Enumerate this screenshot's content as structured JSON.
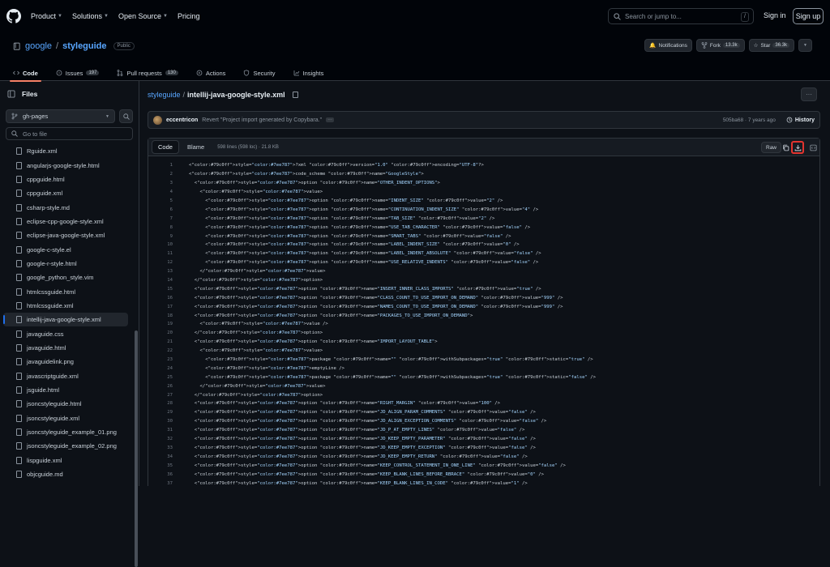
{
  "topbar": {
    "nav": [
      {
        "label": "Product",
        "has_dropdown": true
      },
      {
        "label": "Solutions",
        "has_dropdown": true
      },
      {
        "label": "Open Source",
        "has_dropdown": true
      },
      {
        "label": "Pricing",
        "has_dropdown": false
      }
    ],
    "search_placeholder": "Search or jump to...",
    "search_shortcut": "/",
    "signin": "Sign in",
    "signup": "Sign up"
  },
  "repo": {
    "owner": "google",
    "separator": "/",
    "name": "styleguide",
    "visibility": "Public",
    "notifications": "Notifications",
    "fork_label": "Fork",
    "fork_count": "13.3k",
    "star_label": "Star",
    "star_count": "36.3k"
  },
  "tabs": [
    {
      "label": "Code",
      "active": true,
      "count": ""
    },
    {
      "label": "Issues",
      "active": false,
      "count": "197"
    },
    {
      "label": "Pull requests",
      "active": false,
      "count": "130"
    },
    {
      "label": "Actions",
      "active": false,
      "count": ""
    },
    {
      "label": "Security",
      "active": false,
      "count": ""
    },
    {
      "label": "Insights",
      "active": false,
      "count": ""
    }
  ],
  "sidebar": {
    "title": "Files",
    "branch": "gh-pages",
    "goto_placeholder": "Go to file",
    "files": [
      "Rguide.xml",
      "angularjs-google-style.html",
      "cppguide.html",
      "cppguide.xml",
      "csharp-style.md",
      "eclipse-cpp-google-style.xml",
      "eclipse-java-google-style.xml",
      "google-c-style.el",
      "google-r-style.html",
      "google_python_style.vim",
      "htmlcssguide.html",
      "htmlcssguide.xml",
      "intellij-java-google-style.xml",
      "javaguide.css",
      "javaguide.html",
      "javaguidelink.png",
      "javascriptguide.xml",
      "jsguide.html",
      "jsoncstyleguide.html",
      "jsoncstyleguide.xml",
      "jsoncstyleguide_example_01.png",
      "jsoncstyleguide_example_02.png",
      "lispguide.xml",
      "objcguide.md"
    ],
    "active_index": 12
  },
  "file": {
    "root": "styleguide",
    "separator": "/",
    "name": "intellij-java-google-style.xml",
    "more": "···",
    "commit": {
      "author": "eccentricon",
      "message": "Revert \"Project import generated by Copybara.\"",
      "ellipsis": "···",
      "meta": "505ba68 · 7 years ago",
      "history": "History"
    },
    "view_code": "Code",
    "view_blame": "Blame",
    "info": "598 lines (598 loc) · 21.8 KB",
    "raw": "Raw"
  },
  "code_lines": [
    "<?xml version=\"1.0\" encoding=\"UTF-8\"?>",
    "<code_scheme name=\"GoogleStyle\">",
    "  <option name=\"OTHER_INDENT_OPTIONS\">",
    "    <value>",
    "      <option name=\"INDENT_SIZE\" value=\"2\" />",
    "      <option name=\"CONTINUATION_INDENT_SIZE\" value=\"4\" />",
    "      <option name=\"TAB_SIZE\" value=\"2\" />",
    "      <option name=\"USE_TAB_CHARACTER\" value=\"false\" />",
    "      <option name=\"SMART_TABS\" value=\"false\" />",
    "      <option name=\"LABEL_INDENT_SIZE\" value=\"0\" />",
    "      <option name=\"LABEL_INDENT_ABSOLUTE\" value=\"false\" />",
    "      <option name=\"USE_RELATIVE_INDENTS\" value=\"false\" />",
    "    </value>",
    "  </option>",
    "  <option name=\"INSERT_INNER_CLASS_IMPORTS\" value=\"true\" />",
    "  <option name=\"CLASS_COUNT_TO_USE_IMPORT_ON_DEMAND\" value=\"999\" />",
    "  <option name=\"NAMES_COUNT_TO_USE_IMPORT_ON_DEMAND\" value=\"999\" />",
    "  <option name=\"PACKAGES_TO_USE_IMPORT_ON_DEMAND\">",
    "    <value />",
    "  </option>",
    "  <option name=\"IMPORT_LAYOUT_TABLE\">",
    "    <value>",
    "      <package name=\"\" withSubpackages=\"true\" static=\"true\" />",
    "      <emptyLine />",
    "      <package name=\"\" withSubpackages=\"true\" static=\"false\" />",
    "    </value>",
    "  </option>",
    "  <option name=\"RIGHT_MARGIN\" value=\"100\" />",
    "  <option name=\"JD_ALIGN_PARAM_COMMENTS\" value=\"false\" />",
    "  <option name=\"JD_ALIGN_EXCEPTION_COMMENTS\" value=\"false\" />",
    "  <option name=\"JD_P_AT_EMPTY_LINES\" value=\"false\" />",
    "  <option name=\"JD_KEEP_EMPTY_PARAMETER\" value=\"false\" />",
    "  <option name=\"JD_KEEP_EMPTY_EXCEPTION\" value=\"false\" />",
    "  <option name=\"JD_KEEP_EMPTY_RETURN\" value=\"false\" />",
    "  <option name=\"KEEP_CONTROL_STATEMENT_IN_ONE_LINE\" value=\"false\" />",
    "  <option name=\"KEEP_BLANK_LINES_BEFORE_RBRACE\" value=\"0\" />",
    "  <option name=\"KEEP_BLANK_LINES_IN_CODE\" value=\"1\" />"
  ],
  "colors": {
    "tag": "#7ee787",
    "attr": "#79c0ff",
    "string": "#a5d6ff",
    "highlight": "#e3342f"
  }
}
